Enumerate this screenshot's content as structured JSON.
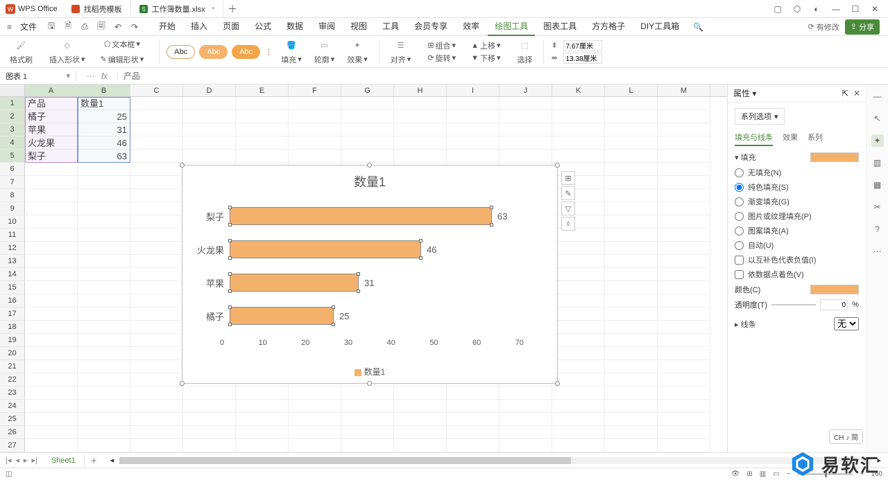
{
  "app": {
    "brand": "WPS Office"
  },
  "tabs": [
    {
      "icon": "template",
      "label": "找稻壳模板",
      "active": false
    },
    {
      "icon": "sheet",
      "label": "工作簿数量.xlsx",
      "active": true
    }
  ],
  "menubar": {
    "file": "文件",
    "items": [
      "开始",
      "插入",
      "页面",
      "公式",
      "数据",
      "审阅",
      "视图",
      "工具",
      "会员专享",
      "效率",
      "绘图工具",
      "图表工具",
      "方方格子",
      "DIY工具箱"
    ],
    "active": "绘图工具",
    "modified": "有修改",
    "share": "分享"
  },
  "ribbon": {
    "format_painter": "格式刷",
    "insert_shape": "插入形状",
    "edit_shape": "编辑形状",
    "textbox": "文本框",
    "abc_samples": [
      "Abc",
      "Abc",
      "Abc"
    ],
    "fill": "填充",
    "outline": "轮廓",
    "effect": "效果",
    "align": "对齐",
    "group": "组合",
    "rotate": "旋转",
    "move_up": "上移",
    "move_down": "下移",
    "select": "选择",
    "width_label": "7.67厘米",
    "height_label": "13.38厘米"
  },
  "formula_bar": {
    "name_box": "图表 1",
    "content": "产品"
  },
  "columns": [
    "A",
    "B",
    "C",
    "D",
    "E",
    "F",
    "G",
    "H",
    "I",
    "J",
    "K",
    "L",
    "M"
  ],
  "sheet_data": {
    "headers": {
      "A1": "产品",
      "B1": "数量1"
    },
    "rows": [
      {
        "product": "橘子",
        "qty": 25
      },
      {
        "product": "苹果",
        "qty": 31
      },
      {
        "product": "火龙果",
        "qty": 46
      },
      {
        "product": "梨子",
        "qty": 63
      }
    ]
  },
  "chart_data": {
    "type": "bar",
    "title": "数量1",
    "categories": [
      "梨子",
      "火龙果",
      "苹果",
      "橘子"
    ],
    "values": [
      63,
      46,
      31,
      25
    ],
    "xlim": [
      0,
      70
    ],
    "xticks": [
      0,
      10,
      20,
      30,
      40,
      50,
      60,
      70
    ],
    "legend": [
      "数量1"
    ],
    "series_color": "#f4b16b"
  },
  "chart_tools": [
    "chart-elements",
    "style-brush",
    "filter",
    "link"
  ],
  "prop_panel": {
    "title": "属性",
    "series_options": "系列选项",
    "tabs": [
      "填充与线条",
      "效果",
      "系列"
    ],
    "tab_active": "填充与线条",
    "section_fill": "填充",
    "fill_modes": [
      {
        "label": "无填充(N)",
        "key": "none"
      },
      {
        "label": "纯色填充(S)",
        "key": "solid"
      },
      {
        "label": "渐变填充(G)",
        "key": "gradient"
      },
      {
        "label": "图片或纹理填充(P)",
        "key": "picture"
      },
      {
        "label": "图案填充(A)",
        "key": "pattern"
      },
      {
        "label": "自动(U)",
        "key": "auto"
      }
    ],
    "fill_selected": "solid",
    "checks": [
      {
        "label": "以互补色代表负值(I)",
        "checked": false
      },
      {
        "label": "依数据点着色(V)",
        "checked": false
      }
    ],
    "color_label": "颜色(C)",
    "transparency_label": "透明度(T)",
    "transparency_value": "0",
    "transparency_unit": "%",
    "section_line": "线条",
    "line_value": "无"
  },
  "right_rail": [
    "collapse",
    "select-arrow",
    "style",
    "chart-props",
    "table",
    "clip",
    "help",
    "more"
  ],
  "sheet_tabs": {
    "sheet": "Sheet1"
  },
  "statusbar": {
    "zoom": "160"
  },
  "ime": "CH ♪ 简",
  "watermark": "易软汇"
}
